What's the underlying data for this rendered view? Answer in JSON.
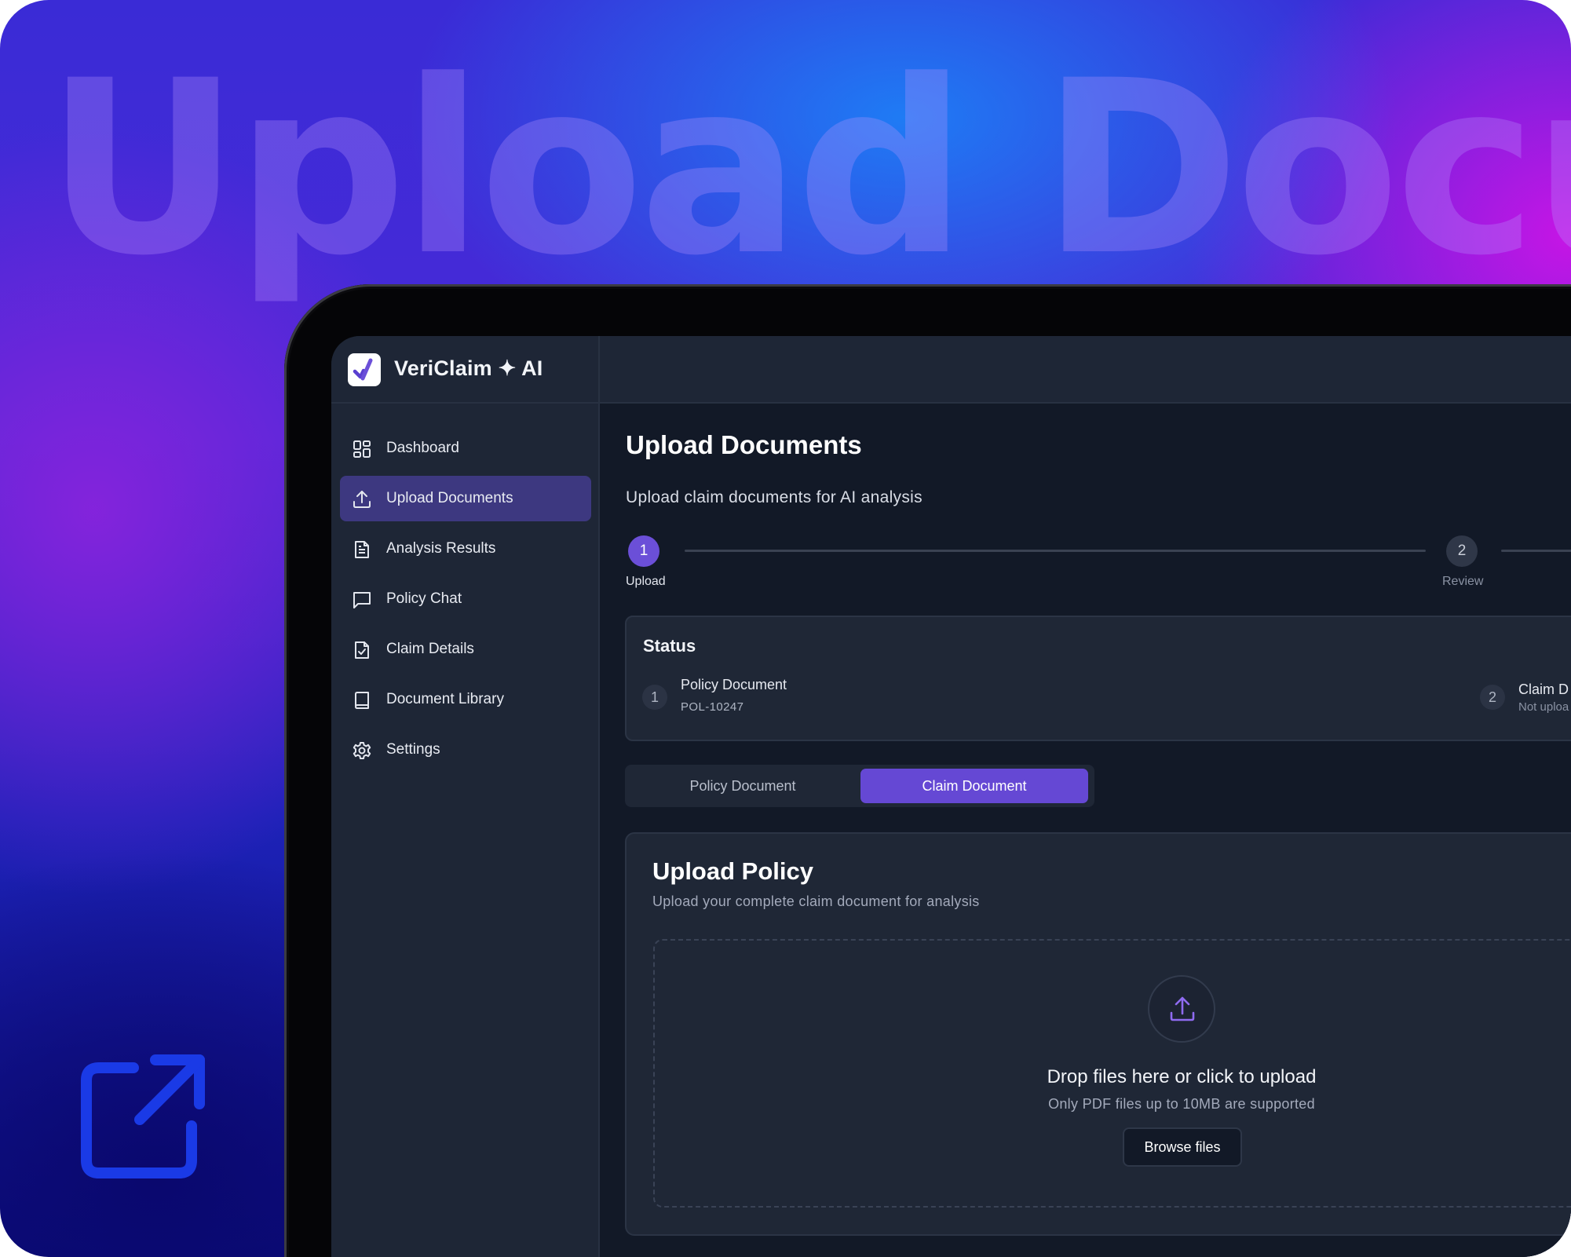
{
  "background": {
    "headline": "Upload Docu",
    "colors": {
      "blue": "#1496ff",
      "magenta": "#cd14e6",
      "violet": "#8723dc",
      "navy": "#0a086e"
    }
  },
  "external_link_icon": "external-link-icon",
  "app": {
    "brand": "VeriClaim ✦ AI",
    "accent_color": "#6548d4"
  },
  "sidebar": {
    "items": [
      {
        "label": "Dashboard",
        "icon": "grid-icon",
        "active": false
      },
      {
        "label": "Upload Documents",
        "icon": "upload-icon",
        "active": true
      },
      {
        "label": "Analysis Results",
        "icon": "file-text-icon",
        "active": false
      },
      {
        "label": "Policy Chat",
        "icon": "chat-icon",
        "active": false
      },
      {
        "label": "Claim Details",
        "icon": "file-check-icon",
        "active": false
      },
      {
        "label": "Document Library",
        "icon": "book-icon",
        "active": false
      },
      {
        "label": "Settings",
        "icon": "gear-icon",
        "active": false
      }
    ]
  },
  "main": {
    "title": "Upload Documents",
    "subtitle": "Upload claim documents for AI analysis",
    "stepper": {
      "steps": [
        {
          "number": "1",
          "label": "Upload",
          "active": true
        },
        {
          "number": "2",
          "label": "Review",
          "active": false
        }
      ]
    },
    "status": {
      "title": "Status",
      "items": [
        {
          "number": "1",
          "name": "Policy Document",
          "detail": "POL-10247"
        },
        {
          "number": "2",
          "name": "Claim D",
          "detail": "Not uploa"
        }
      ]
    },
    "tabs": [
      {
        "label": "Policy Document",
        "selected": false
      },
      {
        "label": "Claim Document",
        "selected": true
      }
    ],
    "upload_card": {
      "title": "Upload Policy",
      "subtitle": "Upload your complete claim document for analysis",
      "dropzone": {
        "title": "Drop files here or click to upload",
        "hint": "Only PDF files up to 10MB are supported",
        "button": "Browse files"
      }
    }
  }
}
